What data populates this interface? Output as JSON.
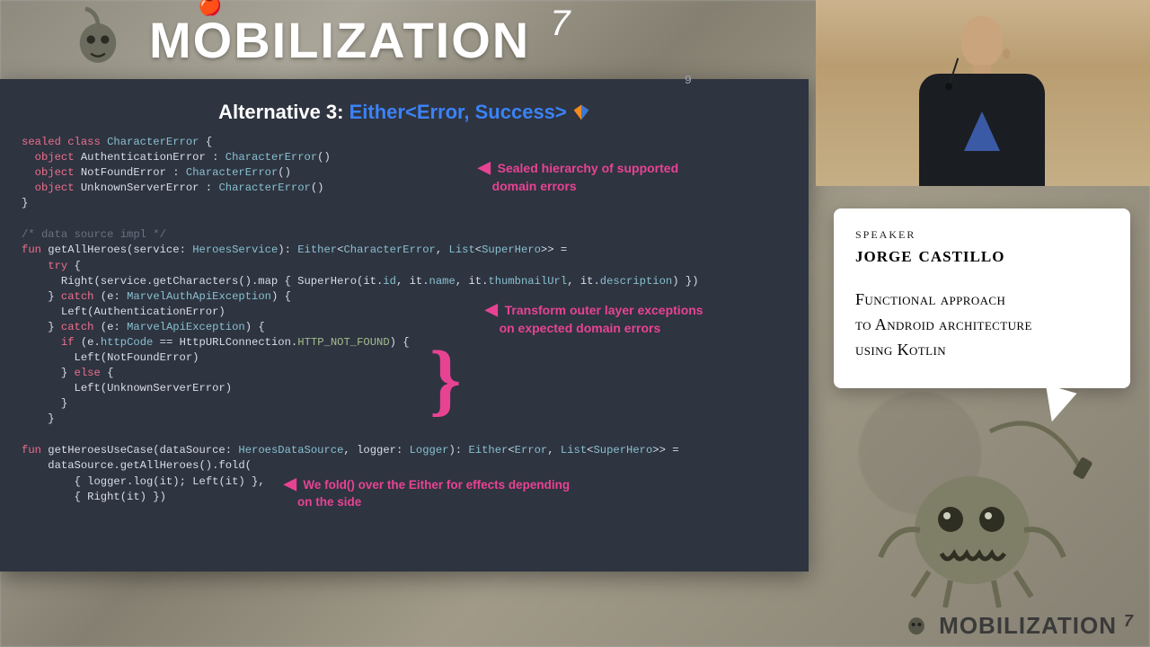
{
  "header": {
    "brand": "MOBILIZATION",
    "edition": "7"
  },
  "footer": {
    "brand": "MOBILIZATION",
    "edition": "7"
  },
  "slide": {
    "number": "9",
    "title_white": "Alternative 3:",
    "title_blue": "Either<Error, Success>",
    "annot1_l1": "Sealed hierarchy of  supported",
    "annot1_l2": "domain errors",
    "annot2_l1": "Transform outer layer exceptions",
    "annot2_l2": "on expected domain errors",
    "annot3_l1": "We fold() over the Either for effects depending",
    "annot3_l2": "on the side",
    "code_block_a": "sealed class CharacterError {\n  object AuthenticationError : CharacterError()\n  object NotFoundError : CharacterError()\n  object UnknownServerError : CharacterError()\n}",
    "code_block_b": "/* data source impl */\nfun getAllHeroes(service: HeroesService): Either<CharacterError, List<SuperHero>> =\n    try {\n      Right(service.getCharacters().map { SuperHero(it.id, it.name, it.thumbnailUrl, it.description) })\n    } catch (e: MarvelAuthApiException) {\n      Left(AuthenticationError)\n    } catch (e: MarvelApiException) {\n      if (e.httpCode == HttpURLConnection.HTTP_NOT_FOUND) {\n        Left(NotFoundError)\n      } else {\n        Left(UnknownServerError)\n      }\n    }",
    "code_block_c": "fun getHeroesUseCase(dataSource: HeroesDataSource, logger: Logger): Either<Error, List<SuperHero>> =\n    dataSource.getAllHeroes().fold(\n        { logger.log(it); Left(it) },\n        { Right(it) })"
  },
  "speaker": {
    "label": "SPEAKER",
    "name": "jorge castillo",
    "talk_l1": "Functional approach",
    "talk_l2": "to Android architecture",
    "talk_l3": "using Kotlin"
  }
}
